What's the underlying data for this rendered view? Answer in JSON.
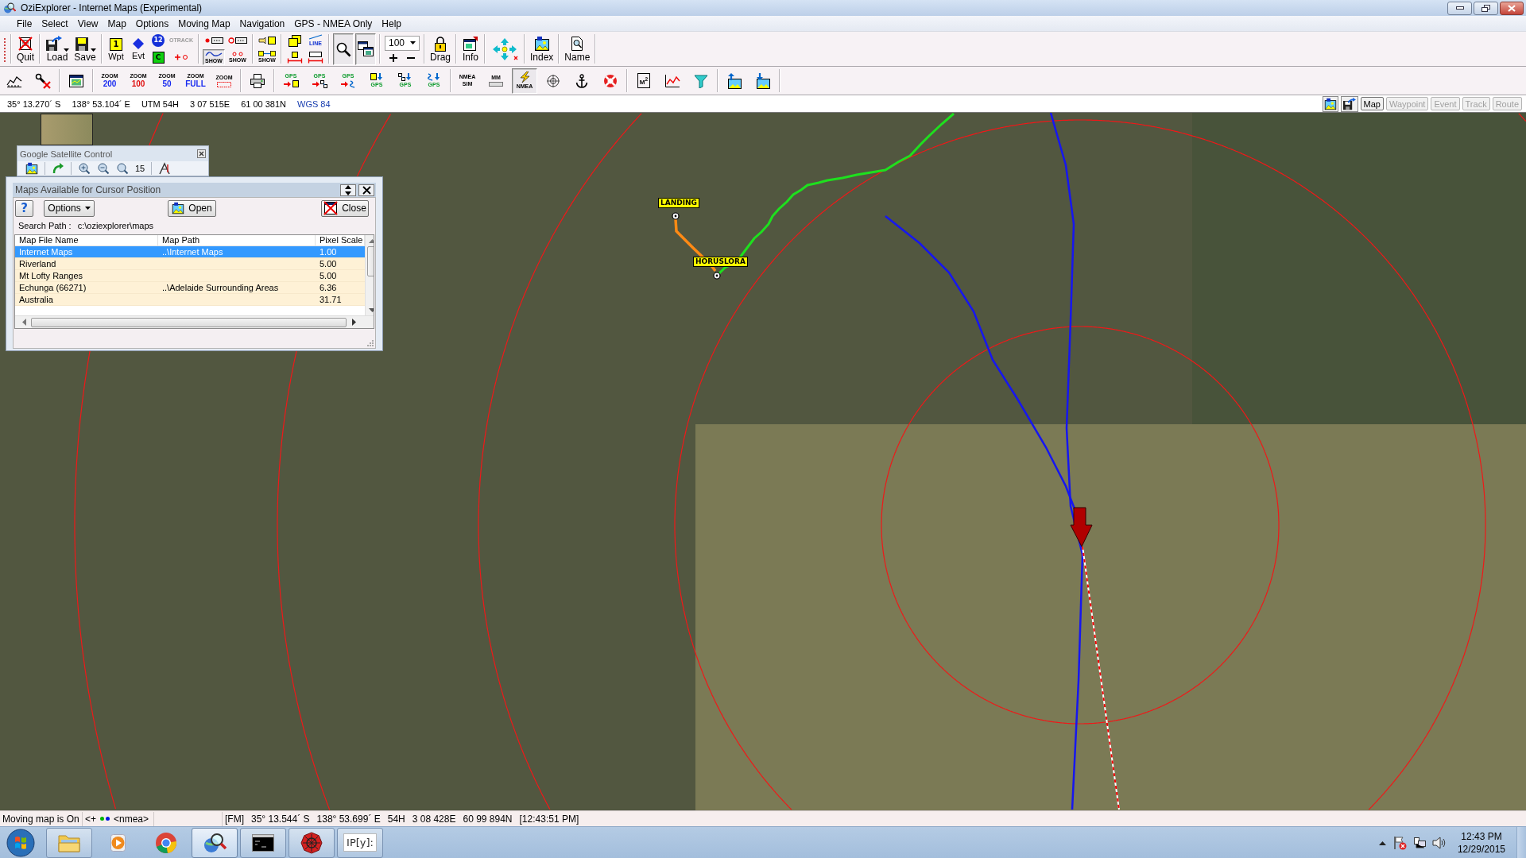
{
  "window": {
    "title": "OziExplorer - Internet Maps (Experimental)"
  },
  "menu": [
    "File",
    "Select",
    "View",
    "Map",
    "Options",
    "Moving Map",
    "Navigation",
    "GPS - NMEA Only",
    "Help"
  ],
  "toolbar_main": [
    {
      "kind": "buttons",
      "columns": [
        [
          {
            "kind": "quit",
            "label": "Quit",
            "on": false
          }
        ]
      ]
    },
    {
      "kind": "buttons",
      "columns": [
        [
          {
            "kind": "load",
            "label": "Load",
            "on": false
          }
        ],
        [
          {
            "kind": "save",
            "label": "Save",
            "on": false
          }
        ]
      ]
    },
    {
      "kind": "buttons",
      "columns": [
        [
          {
            "kind": "waypoint",
            "label": "Wpt",
            "text": "1",
            "on": false
          }
        ],
        [
          {
            "kind": "event",
            "label": "Evt",
            "on": false
          }
        ],
        [
          {
            "kind": "route",
            "text": "12",
            "on": false
          },
          {
            "kind": "route-end",
            "text": "C",
            "on": false
          }
        ],
        [
          {
            "kind": "track",
            "lines": [
              "OTRACK"
            ],
            "on": false
          },
          {
            "kind": "add-point",
            "on": false
          }
        ]
      ]
    },
    {
      "kind": "buttons",
      "columns": [
        [
          {
            "kind": "dot-bar",
            "on": false
          },
          {
            "kind": "show-graph",
            "lines": [
              "SHOW"
            ],
            "on": true
          }
        ],
        [
          {
            "kind": "ring-bar",
            "on": false
          },
          {
            "kind": "show-rings",
            "lines": [
              "SHOW"
            ],
            "on": false
          }
        ]
      ]
    },
    {
      "kind": "buttons",
      "columns": [
        [
          {
            "kind": "pointer-bar",
            "on": false
          },
          {
            "kind": "show-pointer",
            "lines": [
              "SHOW"
            ],
            "on": false
          }
        ]
      ]
    },
    {
      "kind": "buttons",
      "columns": [
        [
          {
            "kind": "sheets",
            "on": false
          },
          {
            "kind": "measure",
            "on": false
          }
        ],
        [
          {
            "kind": "line",
            "lines": [
              "LINE"
            ],
            "on": false
          },
          {
            "kind": "measure-bar",
            "on": false
          }
        ]
      ]
    },
    {
      "kind": "buttons",
      "columns": [
        [
          {
            "kind": "magnifier",
            "on": true
          }
        ],
        [
          {
            "kind": "windows",
            "on": true
          }
        ]
      ]
    },
    {
      "kind": "scale",
      "value": "100"
    },
    {
      "kind": "buttons",
      "columns": [
        [
          {
            "kind": "lock",
            "label": "Drag",
            "on": false
          }
        ]
      ]
    },
    {
      "kind": "buttons",
      "columns": [
        [
          {
            "kind": "info",
            "label": "Info",
            "on": false
          }
        ]
      ]
    },
    {
      "kind": "buttons",
      "columns": [
        [
          {
            "kind": "arrows",
            "on": false
          }
        ]
      ]
    },
    {
      "kind": "buttons",
      "columns": [
        [
          {
            "kind": "index",
            "label": "Index",
            "on": false
          }
        ]
      ]
    },
    {
      "kind": "buttons",
      "columns": [
        [
          {
            "kind": "name",
            "label": "Name",
            "on": false
          }
        ]
      ]
    }
  ],
  "toolbar_second": [
    {
      "kind": "buttons",
      "columns": [
        [
          {
            "kind": "terrain",
            "on": false
          }
        ],
        [
          {
            "kind": "tool-x",
            "on": false
          }
        ]
      ]
    },
    {
      "kind": "buttons",
      "columns": [
        [
          {
            "kind": "map-window",
            "on": false
          }
        ]
      ]
    },
    {
      "kind": "buttons",
      "columns": [
        [
          {
            "kind": "zoom",
            "lines": [
              "ZOOM",
              "200"
            ],
            "color": "#1a2cf0",
            "on": false
          }
        ],
        [
          {
            "kind": "zoom",
            "lines": [
              "ZOOM",
              "100"
            ],
            "color": "#e01010",
            "on": false
          }
        ],
        [
          {
            "kind": "zoom",
            "lines": [
              "ZOOM",
              "50"
            ],
            "color": "#1a2cf0",
            "on": false
          }
        ],
        [
          {
            "kind": "zoom",
            "lines": [
              "ZOOM",
              "FULL"
            ],
            "color": "#1a2cf0",
            "on": false
          }
        ],
        [
          {
            "kind": "zoom-box",
            "lines": [
              "ZOOM"
            ],
            "on": false
          }
        ]
      ]
    },
    {
      "kind": "buttons",
      "columns": [
        [
          {
            "kind": "printer",
            "on": false
          }
        ]
      ]
    },
    {
      "kind": "buttons",
      "columns": [
        [
          {
            "kind": "gps-in-wpt",
            "lines": [
              "GPS"
            ],
            "on": false
          }
        ],
        [
          {
            "kind": "gps-in-route",
            "lines": [
              "GPS"
            ],
            "on": false
          }
        ],
        [
          {
            "kind": "gps-in-track",
            "lines": [
              "GPS"
            ],
            "on": false
          }
        ],
        [
          {
            "kind": "gps-out-wpt",
            "lines": [
              "GPS"
            ],
            "on": false
          }
        ],
        [
          {
            "kind": "gps-out-route",
            "lines": [
              "GPS"
            ],
            "on": false
          }
        ],
        [
          {
            "kind": "gps-out-track",
            "lines": [
              "GPS"
            ],
            "on": false
          }
        ]
      ]
    },
    {
      "kind": "buttons",
      "columns": [
        [
          {
            "kind": "nmea-sim",
            "lines": [
              "NMEA",
              "SIM"
            ],
            "on": false
          }
        ],
        [
          {
            "kind": "mm",
            "lines": [
              "MM"
            ],
            "on": false
          }
        ],
        [
          {
            "kind": "nmea",
            "lines": [
              "NMEA"
            ],
            "on": true
          }
        ],
        [
          {
            "kind": "crosshair",
            "on": false
          }
        ],
        [
          {
            "kind": "anchor",
            "on": false
          }
        ],
        [
          {
            "kind": "lifebuoy",
            "on": false
          }
        ]
      ]
    },
    {
      "kind": "buttons",
      "columns": [
        [
          {
            "kind": "m2",
            "lines": [
              "M$^{2}$"
            ],
            "on": false
          }
        ],
        [
          {
            "kind": "chart",
            "on": false
          }
        ],
        [
          {
            "kind": "funnel",
            "on": false
          }
        ]
      ]
    },
    {
      "kind": "buttons",
      "columns": [
        [
          {
            "kind": "image-up",
            "on": false
          }
        ],
        [
          {
            "kind": "image-down",
            "on": false
          }
        ]
      ]
    }
  ],
  "coordinate_bar": {
    "values": [
      {
        "kind": "value",
        "text": "35° 13.270´ S"
      },
      {
        "kind": "value",
        "text": "138° 53.104´ E"
      },
      {
        "kind": "value",
        "text": "UTM 54H"
      },
      {
        "kind": "value",
        "text": "3 07 515E"
      },
      {
        "kind": "value",
        "text": "61 00 381N"
      },
      {
        "kind": "datum",
        "text": "WGS 84"
      }
    ],
    "layers": [
      {
        "label": "Map",
        "disabled": false
      },
      {
        "label": "Waypoint",
        "disabled": true
      },
      {
        "label": "Event",
        "disabled": true
      },
      {
        "label": "Track",
        "disabled": true
      },
      {
        "label": "Route",
        "disabled": true
      }
    ]
  },
  "map": {
    "waypoints": [
      {
        "label": "LANDING"
      },
      {
        "label": "HORUSLORA"
      }
    ]
  },
  "satellite_control": {
    "title": "Google Satellite Control",
    "zoom_level": "15"
  },
  "maps_dialog": {
    "title": "Maps Available for Cursor Position",
    "help": "?",
    "options": "Options",
    "open": "Open",
    "close": "Close",
    "search_label": "Search Path :",
    "search_path": "c:\\oziexplorer\\maps",
    "columns": [
      "Map File Name",
      "Map Path",
      "Pixel Scale"
    ],
    "rows": [
      {
        "name": "Internet Maps",
        "path": "..\\Internet Maps",
        "scale": "1.00",
        "selected": true
      },
      {
        "name": "Riverland",
        "scale": "5.00",
        "selected": false
      },
      {
        "name": "Mt Lofty Ranges",
        "scale": "5.00",
        "selected": false
      },
      {
        "name": "Echunga (66271)",
        "path": "..\\Adelaide Surrounding Areas",
        "scale": "6.36",
        "selected": false
      },
      {
        "name": "Australia",
        "scale": "31.71",
        "selected": false
      }
    ]
  },
  "status_bar": {
    "moving_map": "Moving map is On",
    "link": "<+",
    "indicators": [
      {
        "color": "#00b400"
      },
      {
        "color": "#0018e0"
      }
    ],
    "source": "<nmea>",
    "fields": [
      "[FM]",
      "35° 13.544´ S",
      "138° 53.699´ E",
      "54H",
      "3 08 428E",
      "60 99 894N",
      "[12:43:51 PM]"
    ]
  },
  "taskbar": {
    "apps": [
      {
        "kind": "folder",
        "running": true,
        "selected": false
      },
      {
        "kind": "player",
        "running": false,
        "selected": false
      },
      {
        "kind": "browser",
        "running": false,
        "selected": false
      },
      {
        "kind": "mapper",
        "running": true,
        "selected": true
      },
      {
        "kind": "terminal",
        "running": true,
        "selected": false
      },
      {
        "kind": "disc",
        "running": true,
        "selected": false
      },
      {
        "kind": "notebook",
        "text": "IP[y]:",
        "running": true,
        "selected": false
      }
    ],
    "time": "12:43 PM",
    "date": "12/29/2015"
  }
}
